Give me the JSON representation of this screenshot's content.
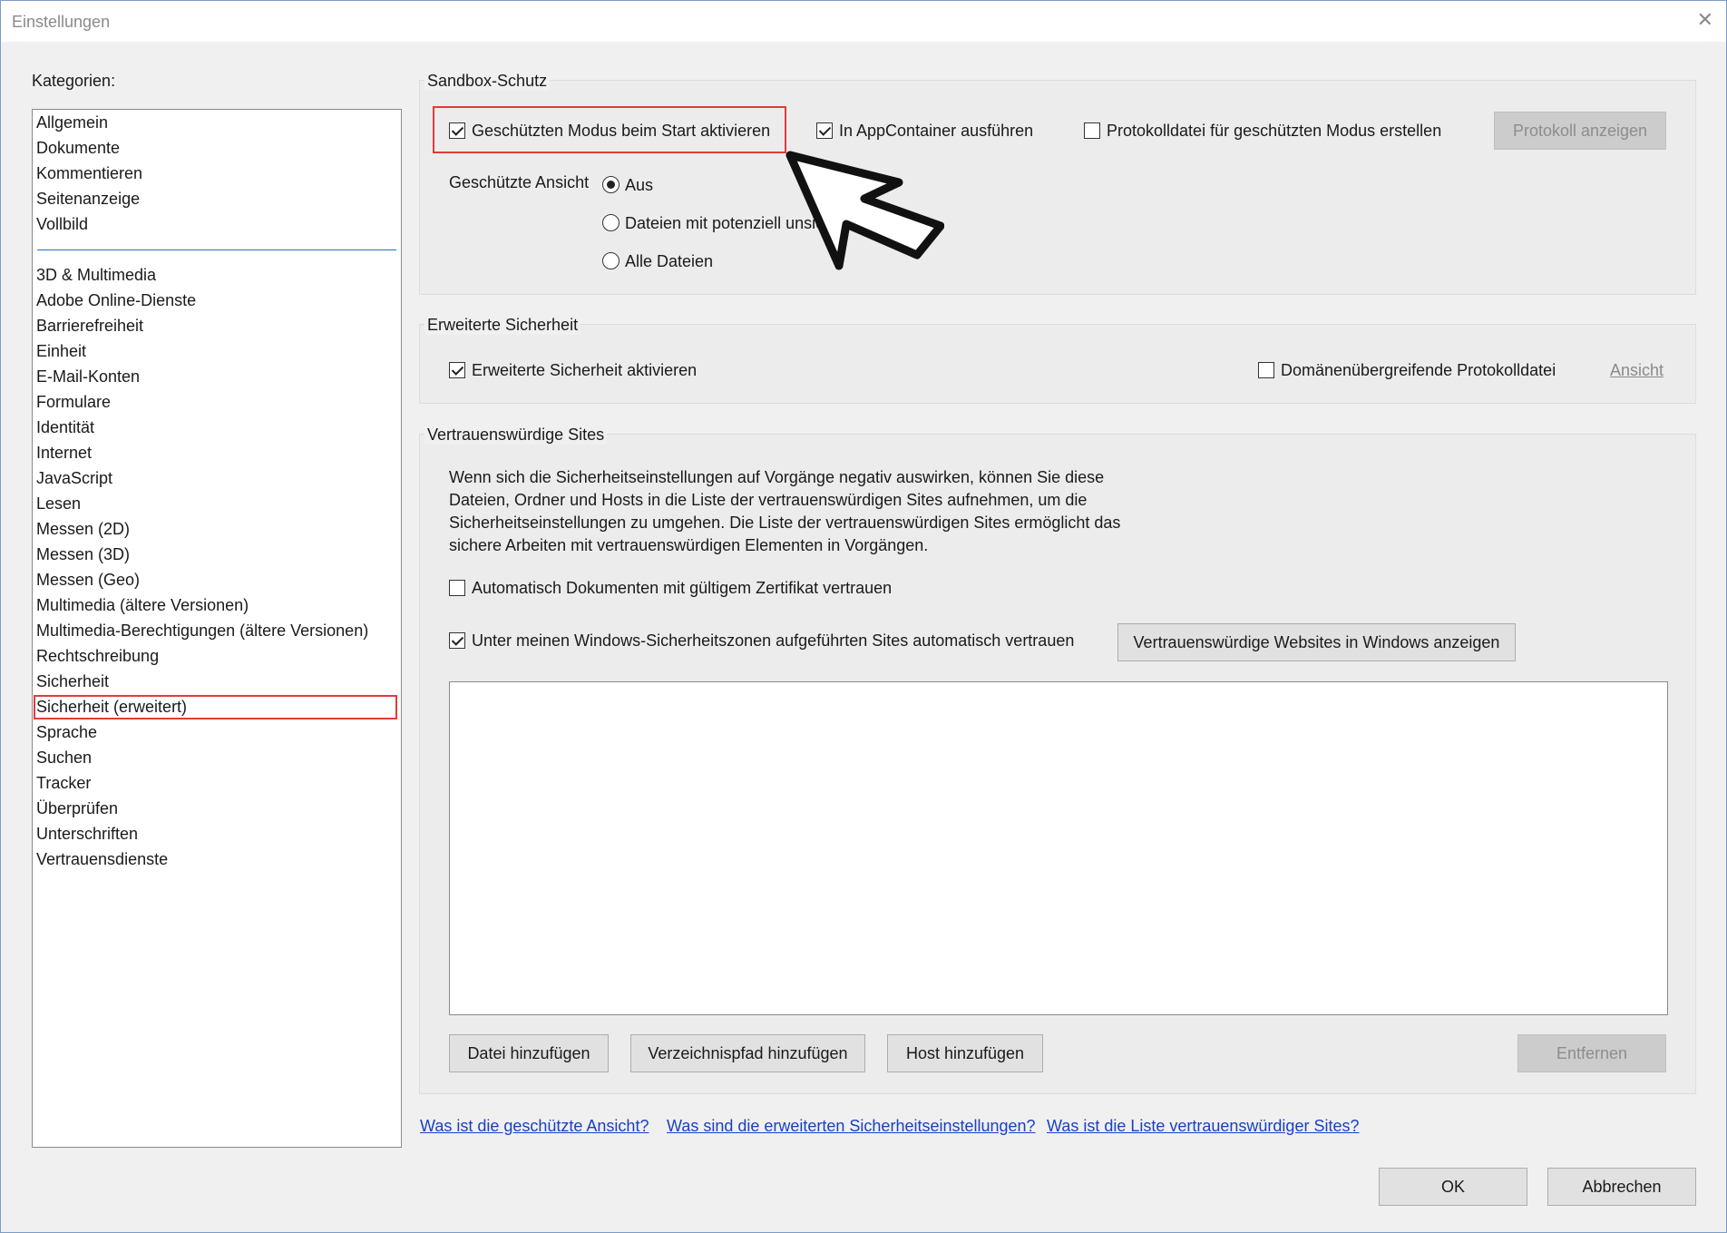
{
  "window": {
    "title": "Einstellungen",
    "close_glyph": "✕"
  },
  "categories": {
    "label": "Kategorien:",
    "group1": [
      "Allgemein",
      "Dokumente",
      "Kommentieren",
      "Seitenanzeige",
      "Vollbild"
    ],
    "group2": [
      "3D & Multimedia",
      "Adobe Online-Dienste",
      "Barrierefreiheit",
      "Einheit",
      "E-Mail-Konten",
      "Formulare",
      "Identität",
      "Internet",
      "JavaScript",
      "Lesen",
      "Messen (2D)",
      "Messen (3D)",
      "Messen (Geo)",
      "Multimedia (ältere Versionen)",
      "Multimedia-Berechtigungen (ältere Versionen)",
      "Rechtschreibung",
      "Sicherheit",
      "Sicherheit (erweitert)",
      "Sprache",
      "Suchen",
      "Tracker",
      "Überprüfen",
      "Unterschriften",
      "Vertrauensdienste"
    ],
    "selected": "Sicherheit (erweitert)"
  },
  "sandbox": {
    "title": "Sandbox-Schutz",
    "protected_mode": {
      "label": "Geschützten Modus beim Start aktivieren",
      "checked": true
    },
    "appcontainer": {
      "label": "In AppContainer ausführen",
      "checked": true
    },
    "logfile": {
      "label": "Protokolldatei für geschützten Modus erstellen",
      "checked": false
    },
    "show_log_button": "Protokoll anzeigen",
    "protected_view": {
      "label": "Geschützte Ansicht",
      "options": [
        "Aus",
        "Dateien mit potenziell unsiche",
        "Alle Dateien"
      ],
      "selected": "Aus"
    }
  },
  "enhanced": {
    "title": "Erweiterte Sicherheit",
    "enable": {
      "label": "Erweiterte Sicherheit aktivieren",
      "checked": true
    },
    "crossdomain": {
      "label": "Domänenübergreifende Protokolldatei",
      "checked": false
    },
    "view_link": "Ansicht"
  },
  "trusted": {
    "title": "Vertrauenswürdige Sites",
    "description": "Wenn sich die Sicherheitseinstellungen auf Vorgänge negativ auswirken,  können Sie diese Dateien, Ordner und Hosts in die Liste der vertrauenswürdigen Sites aufnehmen, um die Sicherheitseinstellungen zu umgehen. Die Liste der vertrauenswürdigen Sites ermöglicht das sichere Arbeiten mit vertrauenswürdigen Elementen in Vorgängen.",
    "auto_cert": {
      "label": "Automatisch Dokumenten mit gültigem Zertifikat vertrauen",
      "checked": false
    },
    "win_zones": {
      "label": "Unter meinen Windows-Sicherheitszonen aufgeführten Sites automatisch vertrauen",
      "checked": true
    },
    "show_windows_sites_button": "Vertrauenswürdige Websites in Windows anzeigen",
    "add_file_button": "Datei hinzufügen",
    "add_path_button": "Verzeichnispfad hinzufügen",
    "add_host_button": "Host hinzufügen",
    "remove_button": "Entfernen"
  },
  "help_links": [
    "Was ist die geschützte Ansicht?",
    "Was sind die erweiterten Sicherheitseinstellungen?",
    "Was ist die Liste vertrauenswürdiger Sites?"
  ],
  "footer": {
    "ok": "OK",
    "cancel": "Abbrechen"
  },
  "colors": {
    "highlight": "#e33b3b",
    "link": "#1a40c4",
    "separator": "#2a6bb5"
  }
}
